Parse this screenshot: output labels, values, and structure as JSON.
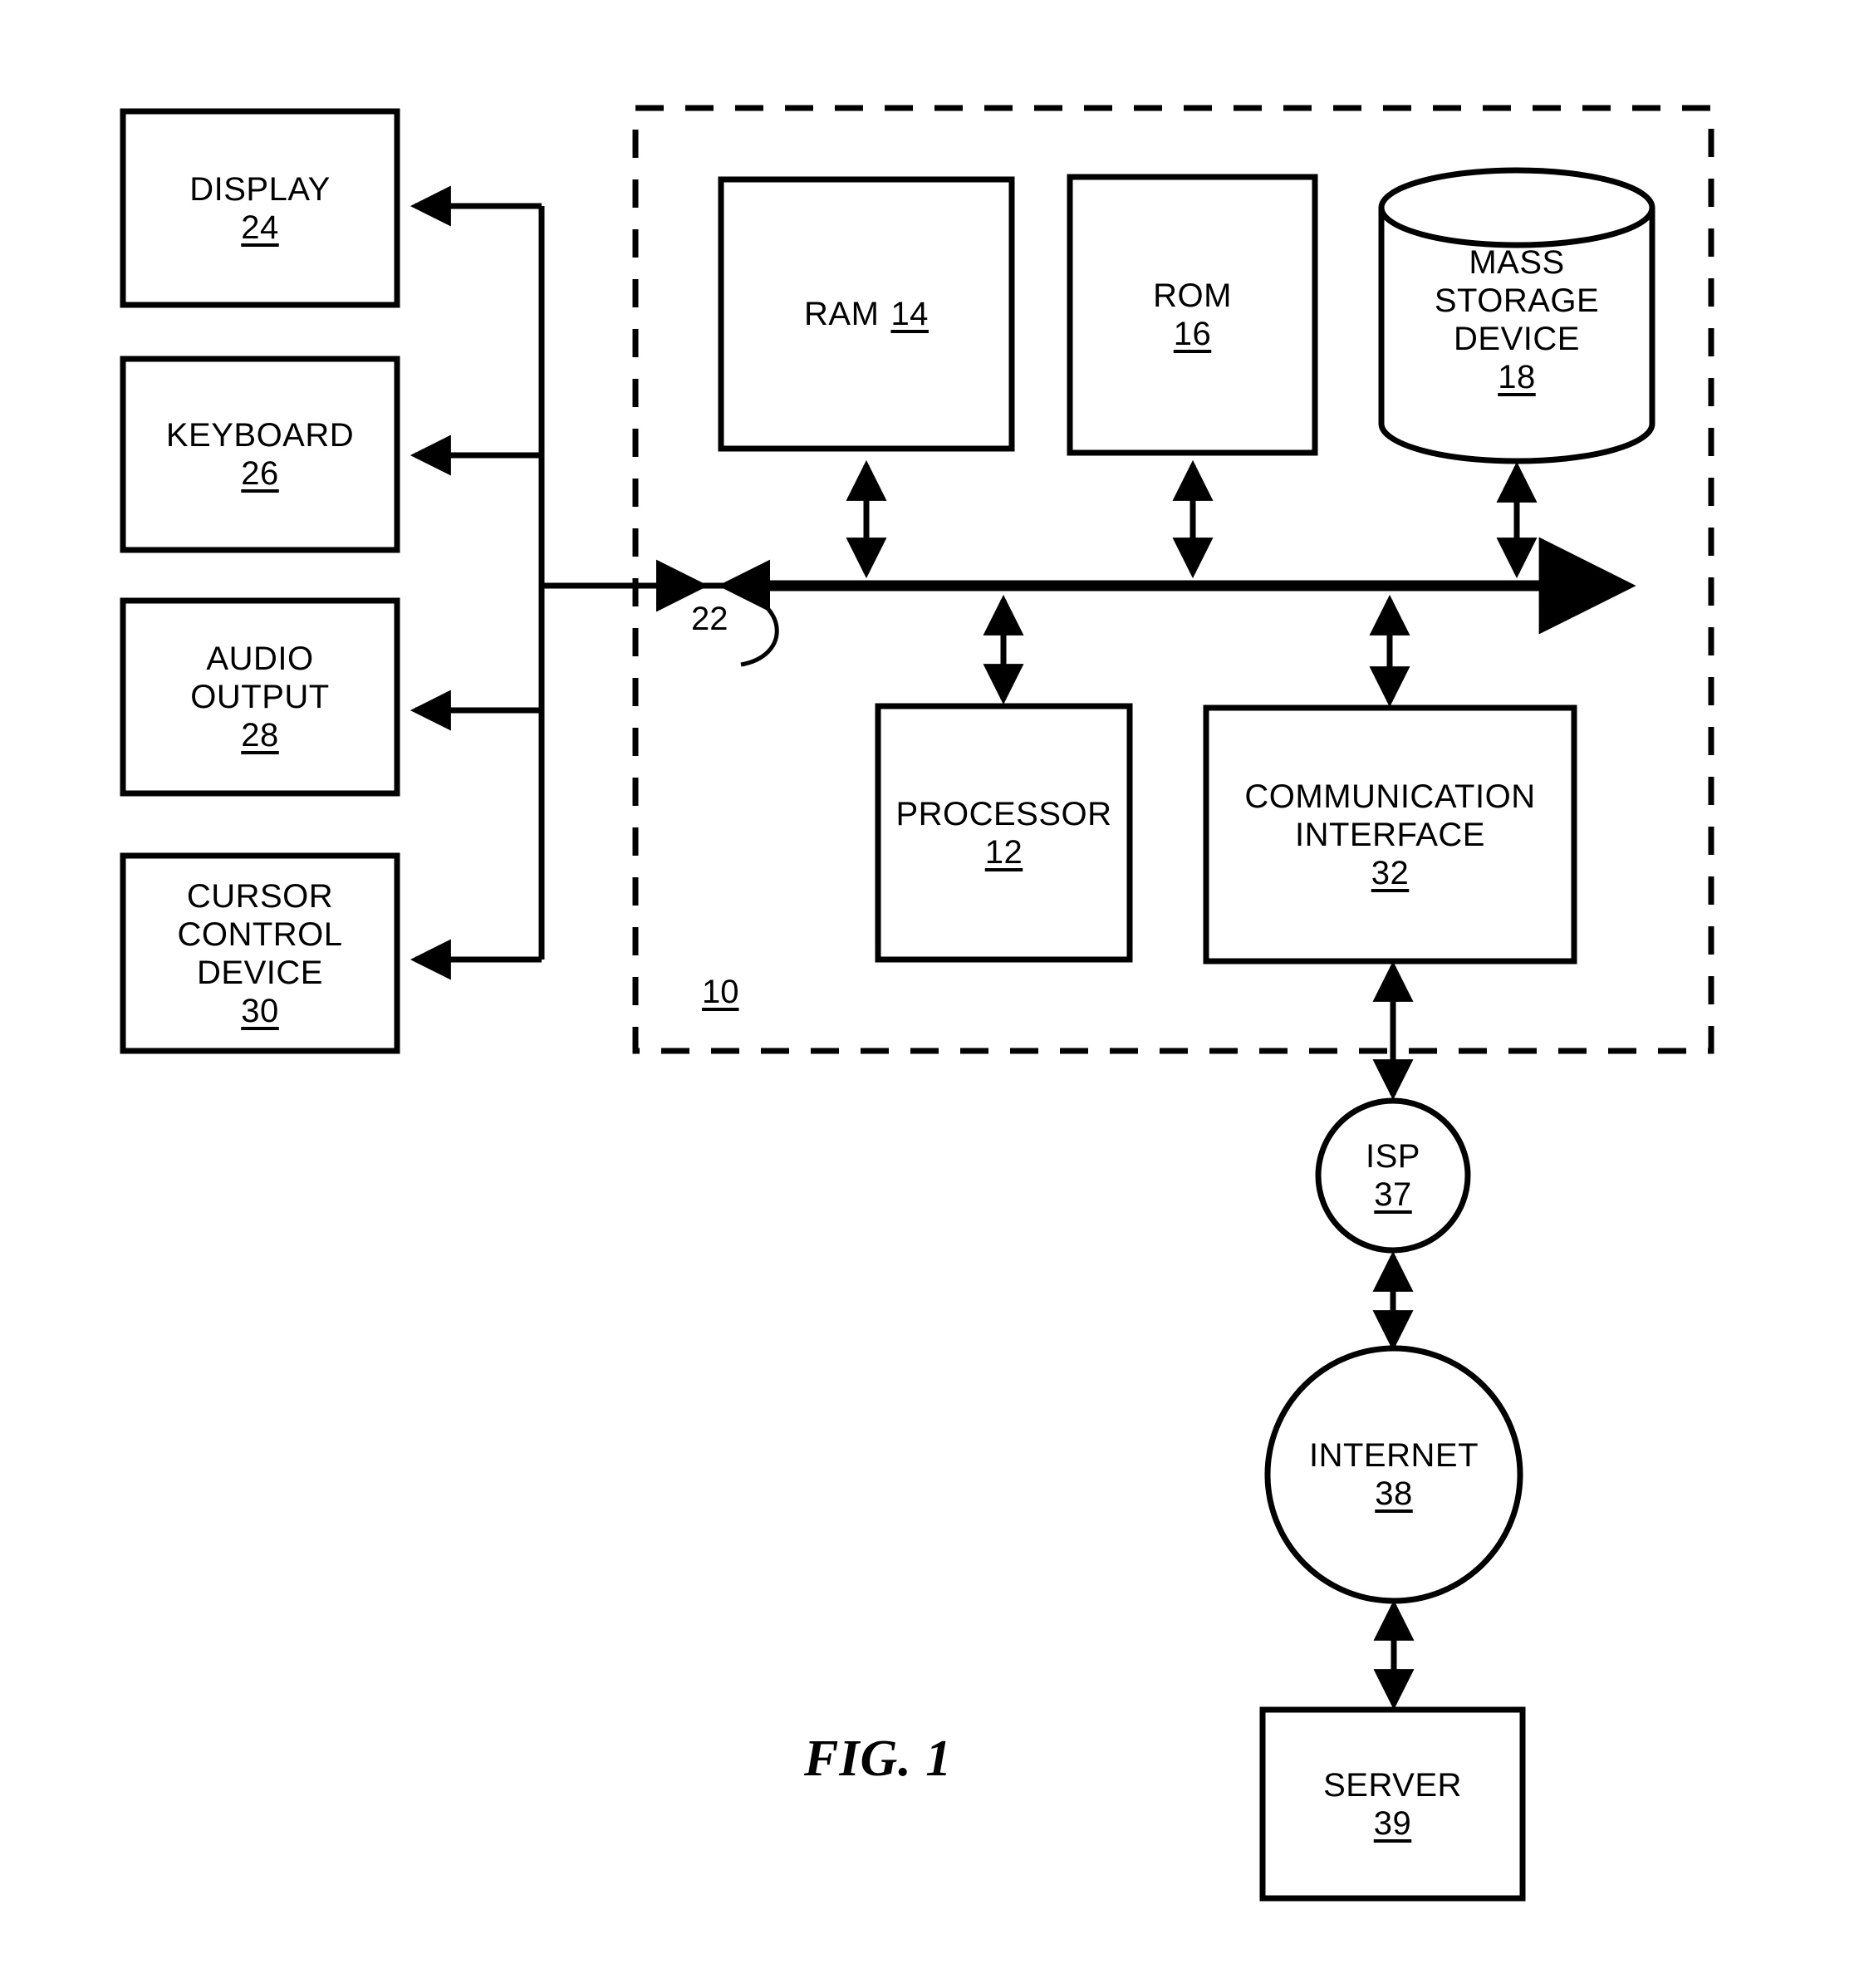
{
  "figure": {
    "caption": "FIG. 1",
    "system_ref": "10",
    "bus_ref": "22"
  },
  "peripherals": [
    {
      "name": "display",
      "lines": [
        "DISPLAY"
      ],
      "ref": "24"
    },
    {
      "name": "keyboard",
      "lines": [
        "KEYBOARD"
      ],
      "ref": "26"
    },
    {
      "name": "audio-output",
      "lines": [
        "AUDIO",
        "OUTPUT"
      ],
      "ref": "28"
    },
    {
      "name": "cursor-control",
      "lines": [
        "CURSOR",
        "CONTROL",
        "DEVICE"
      ],
      "ref": "30"
    }
  ],
  "memory": [
    {
      "name": "ram",
      "lines": [
        "RAM"
      ],
      "ref": "14",
      "inline": true
    },
    {
      "name": "rom",
      "lines": [
        "ROM"
      ],
      "ref": "16",
      "inline": false
    },
    {
      "name": "mass-storage",
      "lines": [
        "MASS",
        "STORAGE",
        "DEVICE"
      ],
      "ref": "18",
      "inline": false
    }
  ],
  "core": [
    {
      "name": "processor",
      "lines": [
        "PROCESSOR"
      ],
      "ref": "12"
    },
    {
      "name": "communication-interface",
      "lines": [
        "COMMUNICATION",
        "INTERFACE"
      ],
      "ref": "32"
    }
  ],
  "network": [
    {
      "name": "isp",
      "lines": [
        "ISP"
      ],
      "ref": "37"
    },
    {
      "name": "internet",
      "lines": [
        "INTERNET"
      ],
      "ref": "38"
    },
    {
      "name": "server",
      "lines": [
        "SERVER"
      ],
      "ref": "39"
    }
  ],
  "colors": {
    "ink": "#000000",
    "paper": "#ffffff"
  }
}
